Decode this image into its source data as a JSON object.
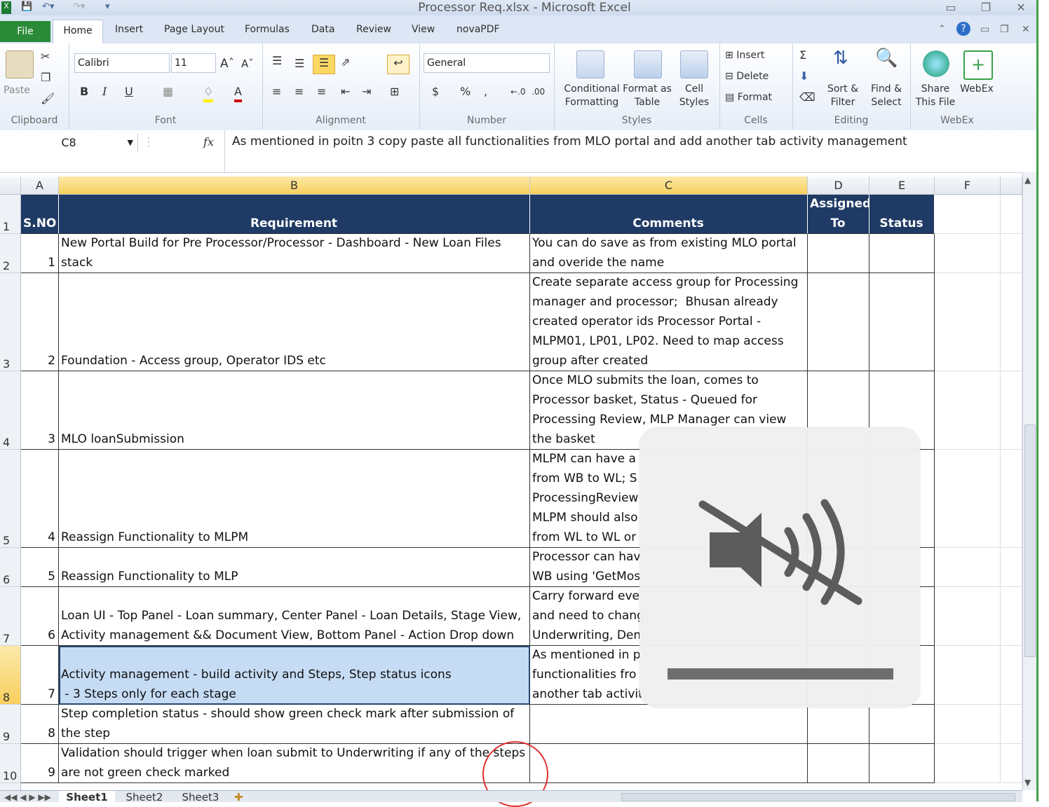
{
  "window": {
    "title": "Processor Req.xlsx - Microsoft Excel"
  },
  "tabs": [
    "File",
    "Home",
    "Insert",
    "Page Layout",
    "Formulas",
    "Data",
    "Review",
    "View",
    "novaPDF"
  ],
  "ribbon": {
    "clipboard": {
      "label": "Clipboard",
      "paste": "Paste"
    },
    "font": {
      "label": "Font",
      "name": "Calibri",
      "size": "11",
      "bold": "B",
      "italic": "I",
      "underline": "U"
    },
    "alignment": {
      "label": "Alignment"
    },
    "number": {
      "label": "Number",
      "format": "General",
      "currency": "$",
      "percent": "%",
      "comma": ","
    },
    "styles": {
      "label": "Styles",
      "conditional_formatting": [
        "Conditional",
        "Formatting"
      ],
      "format_as_table": [
        "Format as",
        "Table"
      ],
      "cell_styles": [
        "Cell",
        "Styles"
      ]
    },
    "cells": {
      "label": "Cells",
      "insert": "Insert",
      "delete": "Delete",
      "format": "Format"
    },
    "editing": {
      "label": "Editing",
      "sort_filter": [
        "Sort &",
        "Filter"
      ],
      "find_select": [
        "Find &",
        "Select"
      ]
    },
    "webex": {
      "label": "WebEx",
      "share": [
        "Share",
        "This File"
      ],
      "webex": "WebEx"
    }
  },
  "formula_bar": {
    "name_box": "C8",
    "fx": "fx",
    "content": "As mentioned in poitn 3 copy paste all functionalities from MLO portal and add another tab activity management"
  },
  "columns": [
    "A",
    "B",
    "C",
    "D",
    "E",
    "F"
  ],
  "rows": [
    {
      "row": "1",
      "a": "S.NO",
      "b": "Requirement",
      "c": "Comments",
      "d": "Assigned\nTo",
      "e": "Status"
    },
    {
      "row": "2",
      "a": "1",
      "b": "New Portal Build for Pre Processor/Processor - Dashboard - New Loan Files\nstack",
      "c": "You can do save as from existing MLO portal\nand overide the name",
      "d": "",
      "e": ""
    },
    {
      "row": "3",
      "a": "2",
      "b": "Foundation - Access group, Operator IDS etc",
      "c": "Create separate access group for Processing\nmanager and processor;  Bhusan already\ncreated operator ids Processor Portal -\nMLPM01, LP01, LP02. Need to map access\ngroup after created",
      "d": "",
      "e": ""
    },
    {
      "row": "4",
      "a": "3",
      "b": "MLO loanSubmission",
      "c": "Once MLO submits the loan, comes to\nProcessor basket, Status - Queued for\nProcessing Review, MLP Manager can view\nthe basket",
      "d": "",
      "e": ""
    },
    {
      "row": "5",
      "a": "4",
      "b": "Reassign Functionality to MLPM",
      "c": "MLPM can have a\nfrom WB to WL; S\nProcessingReview\nMLPM should also\nfrom WL to WL or",
      "d": "",
      "e": ""
    },
    {
      "row": "6",
      "a": "5",
      "b": "Reassign Functionality to MLP",
      "c": "Processor can hav\nWB using 'GetMos",
      "d": "",
      "e": ""
    },
    {
      "row": "7",
      "a": "6",
      "b": "Loan UI - Top Panel - Loan summary, Center Panel - Loan Details, Stage View,\nActivity management && Document View, Bottom Panel - Action Drop down",
      "c": "Carry forward eve\nand need to chang\nUnderwriting, Den",
      "d": "",
      "e": ""
    },
    {
      "row": "8",
      "a": "7",
      "b": "Activity management - build activity and Steps, Step status icons\n - 3 Steps only for each stage",
      "c": "As mentioned in p\nfunctionalities fro\nanother tab activit",
      "d": "",
      "e": ""
    },
    {
      "row": "9",
      "a": "8",
      "b": "Step completion status - should show green check mark after submission of\nthe step",
      "c": "",
      "d": "",
      "e": ""
    },
    {
      "row": "10",
      "a": "9",
      "b": "Validation should trigger when loan submit to Underwriting if any of the steps\nare not green check marked",
      "c": "",
      "d": "",
      "e": ""
    }
  ],
  "sheets": [
    "Sheet1",
    "Sheet2",
    "Sheet3"
  ],
  "colors": {
    "header_fill": "#1f3a64",
    "selection": "#c6dcf5",
    "file_tab": "#2a8a38"
  }
}
